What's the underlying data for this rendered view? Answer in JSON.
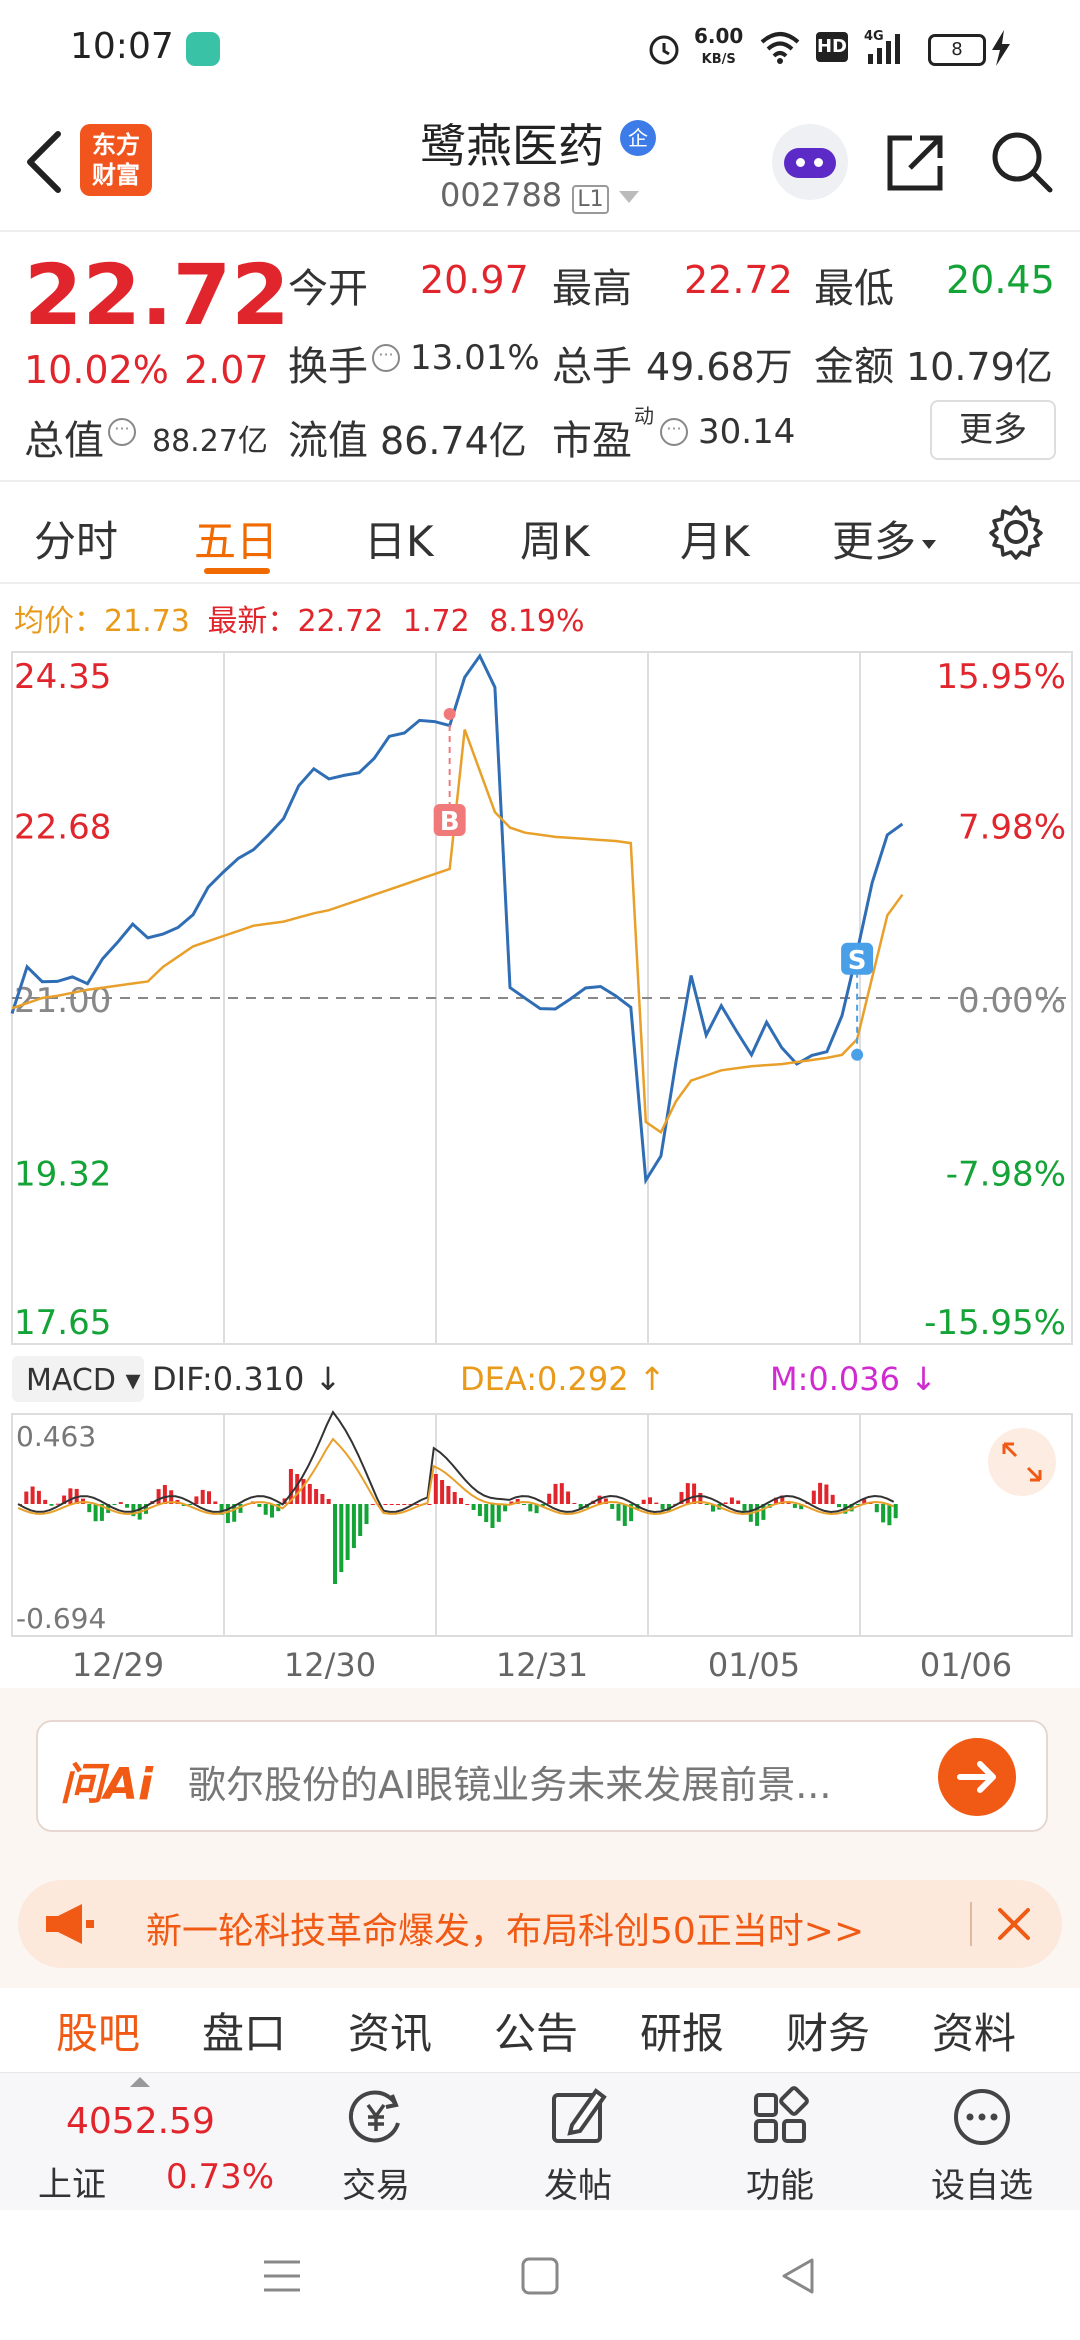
{
  "status_bar": {
    "time": "10:07",
    "net_speed_top": "6.00",
    "net_speed_unit": "KB/S",
    "network": "4G",
    "battery": "8"
  },
  "header": {
    "logo_line1": "东方",
    "logo_line2": "财富",
    "stock_name": "鹭燕医药",
    "badge": "企",
    "stock_code": "002788",
    "level": "L1"
  },
  "quote": {
    "price": "22.72",
    "change_pct": "10.02%",
    "change": "2.07",
    "open_label": "今开",
    "open": "20.97",
    "high_label": "最高",
    "high": "22.72",
    "low_label": "最低",
    "low": "20.45",
    "turnover_label": "换手",
    "turnover": "13.01%",
    "volume_label": "总手",
    "volume": "49.68万",
    "amount_label": "金额",
    "amount": "10.79亿",
    "mktcap_label": "总值",
    "mktcap": "88.27亿",
    "float_label": "流值",
    "float": "86.74亿",
    "pe_label": "市盈",
    "pe_sup": "动",
    "pe": "30.14",
    "more_button": "更多"
  },
  "chart_tabs": [
    "分时",
    "五日",
    "日K",
    "周K",
    "月K",
    "更多"
  ],
  "chart_tab_active": 1,
  "info_line": {
    "avg_label": "均价：",
    "avg": "21.73",
    "latest_label": "最新：",
    "latest": "22.72",
    "chg": "1.72",
    "pct": "8.19%"
  },
  "chart_data": {
    "type": "line",
    "title": "",
    "days": [
      "12/29",
      "12/30",
      "12/31",
      "01/05",
      "01/06"
    ],
    "y_ticks_left": [
      "24.35",
      "22.68",
      "21.00",
      "19.32",
      "17.65"
    ],
    "y_ticks_right": [
      "15.95%",
      "7.98%",
      "0.00%",
      "-7.98%",
      "-15.95%"
    ],
    "ylim": [
      17.65,
      24.35
    ],
    "base_price": 21.0,
    "series": [
      {
        "name": "",
        "color": "#2f6db5",
        "values": [
          20.85,
          21.2,
          21.05,
          21.15,
          21.3,
          21.25,
          21.4,
          21.45,
          21.6,
          21.55,
          21.7,
          21.8,
          21.85,
          22.0,
          22.1,
          22.3,
          22.5,
          22.7,
          22.8,
          23.0,
          23.1,
          23.05,
          23.2,
          23.3,
          23.4,
          23.5,
          23.45,
          23.6,
          23.7,
          23.75,
          24.2,
          24.3,
          23.9,
          21.0,
          21.0,
          21.0,
          21.0,
          21.0,
          21.0,
          21.0,
          21.0,
          21.0,
          19.35,
          19.5,
          20.3,
          21.1,
          20.6,
          21.0,
          20.8,
          20.5,
          20.7,
          20.4,
          20.3,
          20.5,
          20.6,
          20.9,
          21.4,
          22.0,
          22.5,
          22.72
        ]
      },
      {
        "name": "",
        "color": "#e8a02b",
        "values": [
          20.9,
          20.95,
          21.0,
          21.02,
          21.05,
          21.08,
          21.1,
          21.12,
          21.14,
          21.16,
          21.3,
          21.4,
          21.5,
          21.55,
          21.6,
          21.65,
          21.7,
          21.72,
          21.74,
          21.78,
          21.82,
          21.85,
          21.9,
          21.95,
          22.0,
          22.05,
          22.1,
          22.15,
          22.2,
          22.25,
          23.6,
          23.2,
          22.8,
          22.65,
          22.6,
          22.58,
          22.56,
          22.55,
          22.54,
          22.53,
          22.52,
          22.5,
          19.8,
          19.7,
          20.0,
          20.2,
          20.25,
          20.3,
          20.32,
          20.34,
          20.35,
          20.36,
          20.38,
          20.4,
          20.42,
          20.45,
          20.6,
          21.2,
          21.8,
          22.0
        ]
      }
    ],
    "markers": [
      {
        "label": "B",
        "color": "#f07a7a"
      },
      {
        "label": "S",
        "color": "#4aa0e8"
      }
    ]
  },
  "macd": {
    "label": "MACD",
    "dif": "DIF:0.310",
    "dea": "DEA:0.292",
    "m": "M:0.036",
    "top": "0.463",
    "bottom": "-0.694"
  },
  "ai_bar": {
    "logo": "问Ai",
    "placeholder": "歌尔股份的AI眼镜业务未来发展前景..."
  },
  "promo": {
    "text": "新一轮科技革命爆发，布局科创50正当时>>"
  },
  "sub_tabs": [
    "股吧",
    "盘口",
    "资讯",
    "公告",
    "研报",
    "财务",
    "资料"
  ],
  "sub_tab_active": 0,
  "index": {
    "value": "4052.59",
    "name": "上证",
    "pct": "0.73%"
  },
  "bottom_nav": [
    "交易",
    "发帖",
    "功能",
    "设自选"
  ],
  "colors": {
    "up": "#e0262c",
    "down": "#13a336",
    "accent": "#f06a00",
    "price_line": "#2f6db5",
    "avg_line": "#e8a02b"
  }
}
